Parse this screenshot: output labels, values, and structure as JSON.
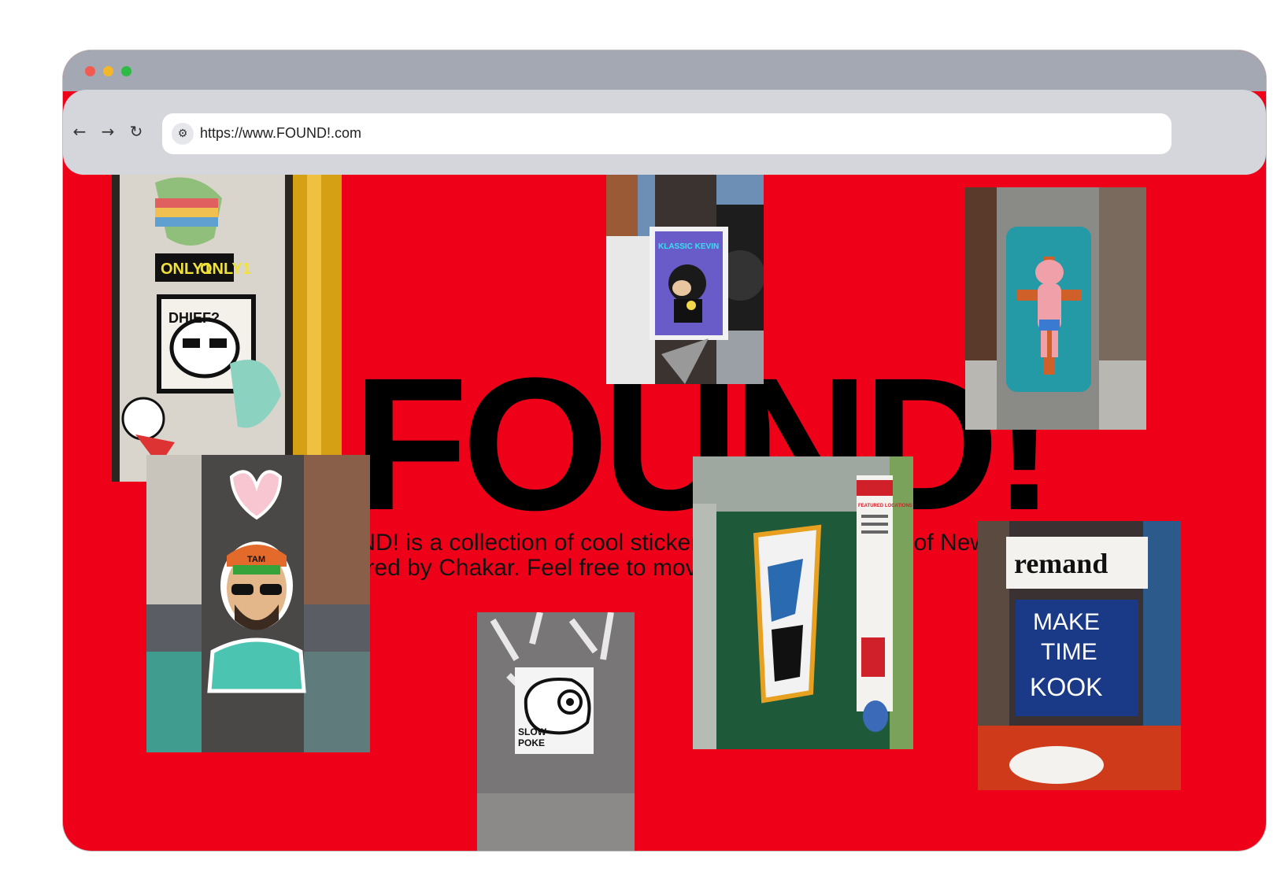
{
  "browser": {
    "url": "https://www.FOUND!.com",
    "nav": {
      "back": "←",
      "forward": "→",
      "reload": "↻"
    }
  },
  "hero": {
    "title": "FOUND!",
    "description": "FOUND! is a collection of cool stickers around the streets of New York City, captured by Chakar. Feel free to move them around"
  },
  "photos": [
    {
      "name": "photo-only1-sticker-pole",
      "texts": [
        "ONLY1",
        "ONLY1",
        "DHIEF?"
      ]
    },
    {
      "name": "photo-klassic-kevin-sticker",
      "texts": [
        "KLASSIC KEVIN"
      ]
    },
    {
      "name": "photo-pink-figure-cross-sticker",
      "texts": []
    },
    {
      "name": "photo-sunglasses-man-sticker",
      "texts": [
        "TAM"
      ]
    },
    {
      "name": "photo-slow-poke-sticker",
      "texts": [
        "SLOW",
        "POKE"
      ]
    },
    {
      "name": "photo-green-pole-stickers",
      "texts": [
        "FEATURED LOCATIONS"
      ]
    },
    {
      "name": "photo-remand-make-time-sticker",
      "texts": [
        "remand",
        "MAKE",
        "TIME",
        "KOOK"
      ]
    }
  ],
  "colors": {
    "page_bg": "#ef0019",
    "chrome": "#a4a8b3",
    "toolbar": "#d4d6db"
  }
}
